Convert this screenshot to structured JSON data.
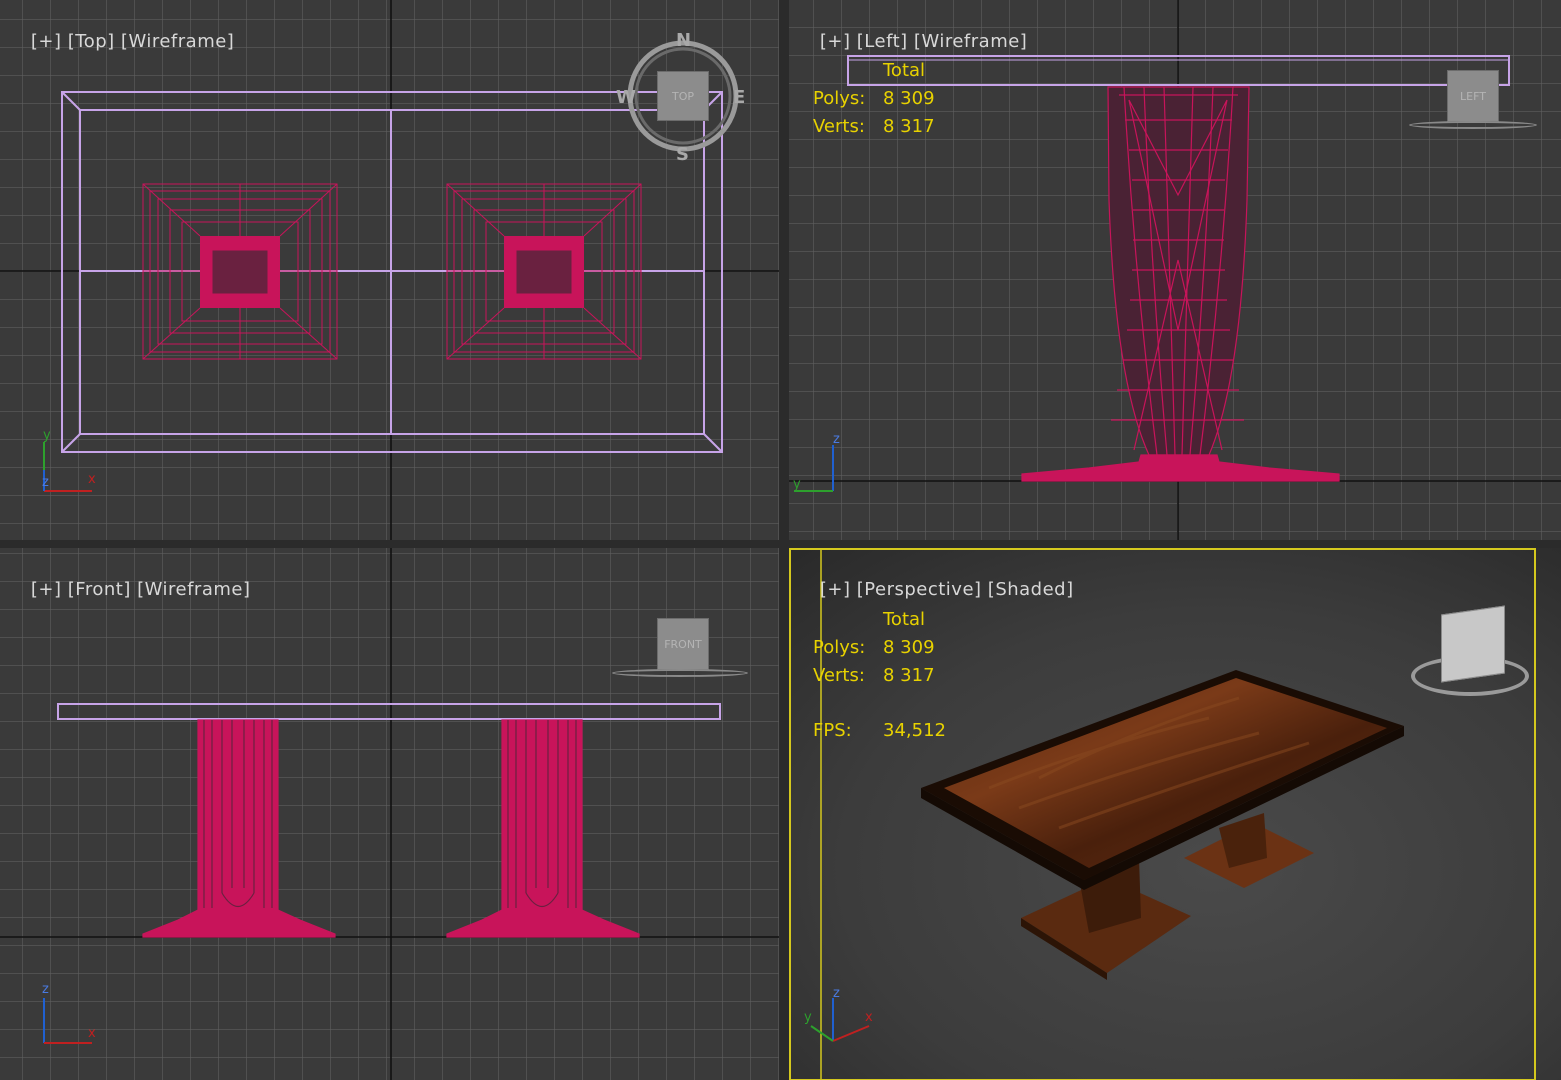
{
  "viewports": {
    "top": {
      "plus": "[+]",
      "view": "[Top]",
      "mode": "[Wireframe]"
    },
    "left": {
      "plus": "[+]",
      "view": "[Left]",
      "mode": "[Wireframe]"
    },
    "front": {
      "plus": "[+]",
      "view": "[Front]",
      "mode": "[Wireframe]"
    },
    "perspective": {
      "plus": "[+]",
      "view": "[Perspective]",
      "mode": "[Shaded]"
    }
  },
  "stats_left": {
    "total_label": "Total",
    "polys_label": "Polys:",
    "polys_value": "8 309",
    "verts_label": "Verts:",
    "verts_value": "8 317"
  },
  "stats_persp": {
    "total_label": "Total",
    "polys_label": "Polys:",
    "polys_value": "8 309",
    "verts_label": "Verts:",
    "verts_value": "8 317",
    "fps_label": "FPS:",
    "fps_value": "34,512"
  },
  "viewcube": {
    "top_face": "TOP",
    "left_face": "LEFT",
    "front_face": "FRONT",
    "compass": {
      "n": "N",
      "s": "S",
      "e": "E",
      "w": "W"
    }
  },
  "axes": {
    "x": "x",
    "y": "y",
    "z": "z"
  },
  "colors": {
    "viewport_bg": "#3a3a3a",
    "grid": "#5e5e5e",
    "grid_axis": "#111111",
    "wire_mesh": "#c8145a",
    "tabletop_wire": "#c7a4e8",
    "stats": "#e8d200",
    "active_border": "#d4c81e"
  }
}
